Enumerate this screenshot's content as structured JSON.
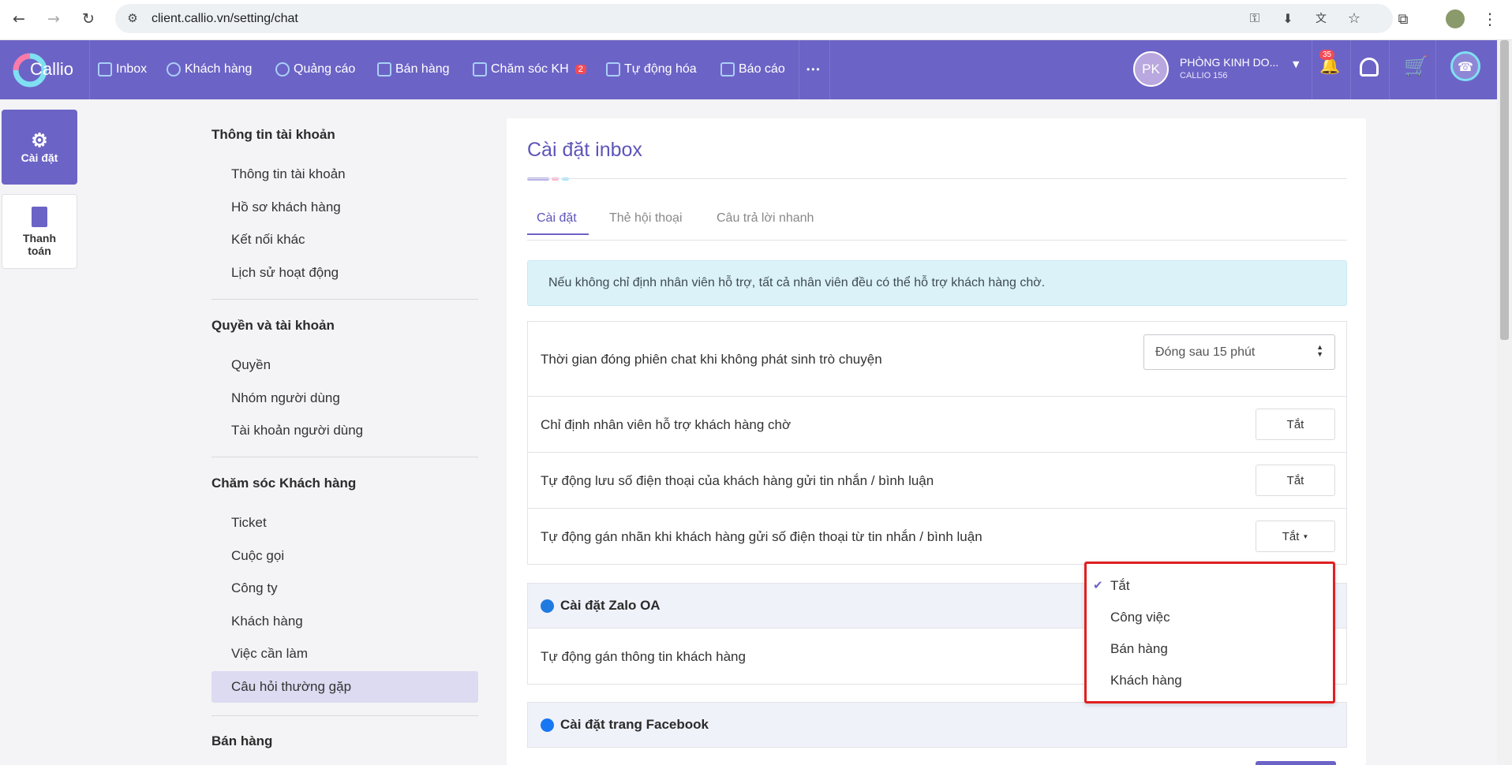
{
  "browser": {
    "url": "client.callio.vn/setting/chat"
  },
  "nav": {
    "logo": "Callio",
    "items": [
      {
        "label": "Inbox",
        "icon": "inbox-icon"
      },
      {
        "label": "Khách hàng",
        "icon": "customers-icon"
      },
      {
        "label": "Quảng cáo",
        "icon": "ads-icon"
      },
      {
        "label": "Bán hàng",
        "icon": "store-icon"
      },
      {
        "label": "Chăm sóc KH",
        "icon": "care-icon",
        "badge": "2"
      },
      {
        "label": "Tự động hóa",
        "icon": "robot-icon"
      },
      {
        "label": "Báo cáo",
        "icon": "report-icon"
      }
    ],
    "more": "•••",
    "user": {
      "initials": "PK",
      "name": "PHÒNG KINH DO...",
      "sub": "CALLIO 156"
    },
    "notif_count": "35"
  },
  "rail": {
    "settings": "Cài đặt",
    "billing": "Thanh toán"
  },
  "menu": {
    "sections": [
      {
        "title": "Thông tin tài khoản",
        "items": [
          "Thông tin tài khoản",
          "Hồ sơ khách hàng",
          "Kết nối khác",
          "Lịch sử hoạt động"
        ]
      },
      {
        "title": "Quyền và tài khoản",
        "items": [
          "Quyền",
          "Nhóm người dùng",
          "Tài khoản người dùng"
        ]
      },
      {
        "title": "Chăm sóc Khách hàng",
        "items": [
          "Ticket",
          "Cuộc gọi",
          "Công ty",
          "Khách hàng",
          "Việc cần làm",
          "Câu hỏi thường gặp"
        ]
      },
      {
        "title": "Bán hàng",
        "items": []
      }
    ],
    "active": "Câu hỏi thường gặp"
  },
  "main": {
    "title": "Cài đặt inbox",
    "tabs": [
      "Cài đặt",
      "Thẻ hội thoại",
      "Câu trả lời nhanh"
    ],
    "info": "Nếu không chỉ định nhân viên hỗ trợ, tất cả nhân viên đều có thể hỗ trợ khách hàng chờ.",
    "rows": [
      {
        "label": "Thời gian đóng phiên chat khi không phát sinh trò chuyện",
        "value": "Đóng sau 15 phút"
      },
      {
        "label": "Chỉ định nhân viên hỗ trợ khách hàng chờ",
        "value": "Tắt"
      },
      {
        "label": "Tự động lưu số điện thoại của khách hàng gửi tin nhắn / bình luận",
        "value": "Tắt"
      },
      {
        "label": "Tự động gán nhãn khi khách hàng gửi số điện thoại từ tin nhắn / bình luận",
        "value": "Tắt"
      }
    ],
    "zalo": {
      "title": "Cài đặt Zalo OA",
      "row": "Tự động gán thông tin khách hàng"
    },
    "facebook": {
      "title": "Cài đặt trang Facebook"
    }
  },
  "dropdown": {
    "options": [
      "Tắt",
      "Công việc",
      "Bán hàng",
      "Khách hàng"
    ],
    "selected": "Tắt"
  }
}
